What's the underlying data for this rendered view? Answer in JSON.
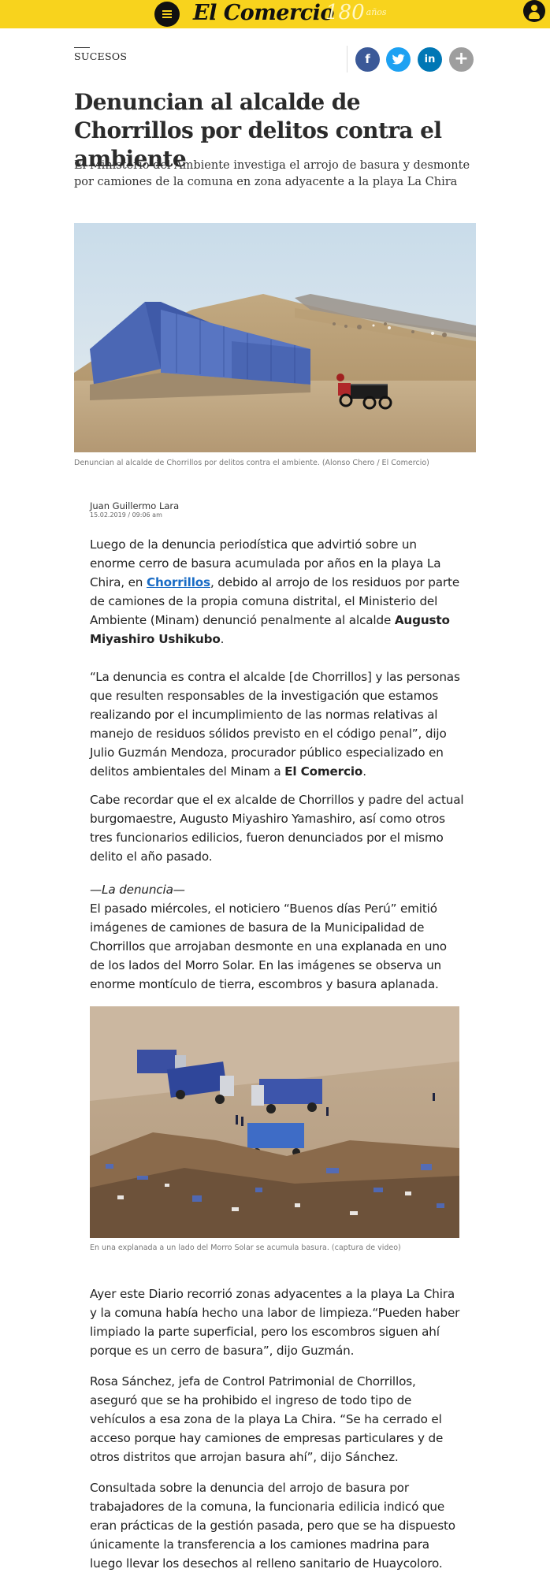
{
  "header": {
    "logo": "El Comercio",
    "anniversary_number": "180",
    "anniversary_word": "años",
    "menu_icon": "hamburger-menu-icon",
    "user_icon": "user-account-icon",
    "bar_color": "#f8d31d"
  },
  "article": {
    "section": "SUCESOS",
    "share": {
      "facebook": "f",
      "twitter": "t",
      "linkedin": "in",
      "more": "+"
    },
    "headline": "Denuncian al alcalde de Chorrillos por delitos contra el ambiente",
    "subtitle": "El Ministerio del Ambiente investiga el arrojo de basura y desmonte por camiones de la comuna en zona adyacente a la playa La Chira",
    "main_image_caption": "Denuncian al alcalde de Chorrillos por delitos contra el ambiente. (Alonso Chero / El Comercio)",
    "author": "Juan Guillermo Lara",
    "date": "15.02.2019 / 09:06 am",
    "p1": {
      "before_link": "Luego de la denuncia periodística que advirtió sobre un enorme cerro de basura acumulada por años en la playa La Chira, en ",
      "link": "Chorrillos",
      "after_link": ", debido al arrojo de los residuos por parte de camiones de la propia comuna distrital, el Ministerio del Ambiente (Minam) denunció penalmente al alcalde ",
      "bold": "Augusto Miyashiro Ushikubo",
      "end": "."
    },
    "p2": {
      "text": "“La denuncia es contra el alcalde [de Chorrillos] y las personas que resulten responsables de la investigación que estamos realizando por el incumplimiento de las normas relativas al manejo de residuos sólidos previsto en el código penal”, dijo Julio Guzmán Mendoza, procurador público especializado en delitos ambientales del Minam a ",
      "bold": "El Comercio",
      "end": "."
    },
    "p3": "Cabe recordar que el ex alcalde de Chorrillos y padre del actual burgomaestre, Augusto Miyashiro Yamashiro, así como otros tres funcionarios edilicios, fueron denunciados por el mismo delito el año pasado.",
    "subhead": "—La denuncia—",
    "p4": "El pasado miércoles, el noticiero “Buenos días Perú” emitió imágenes de camiones de basura de la Municipalidad de Chorrillos que arrojaban desmonte en una explanada en uno de los lados del Morro Solar. En las imágenes se observa un enorme montículo de tierra, escombros y basura aplanada.",
    "second_image_caption": "En una explanada a un lado del Morro Solar se acumula basura. (captura de video)",
    "p5": "Ayer este Diario recorrió zonas adyacentes a la playa La Chira y la comuna había hecho una labor de limpieza.“Pueden haber limpiado la parte superficial, pero los escombros siguen ahí porque es un cerro de basura”, dijo Guzmán.",
    "p6": "Rosa Sánchez, jefa de Control Patrimonial de Chorrillos, aseguró que se ha prohibido el ingreso de todo tipo de vehículos a esa zona de la playa La Chira. “Se ha cerrado el acceso porque hay camiones de empresas particulares y de otros distritos que arrojan basura ahí”, dijo Sánchez.",
    "p7": "Consultada sobre la denuncia del arrojo de basura por trabajadores de la comuna, la funcionaria edilicia indicó que eran prácticas de la gestión pasada, pero que se ha dispuesto únicamente la transferencia a los camiones madrina para luego llevar los desechos al relleno sanitario de Huaycoloro."
  }
}
